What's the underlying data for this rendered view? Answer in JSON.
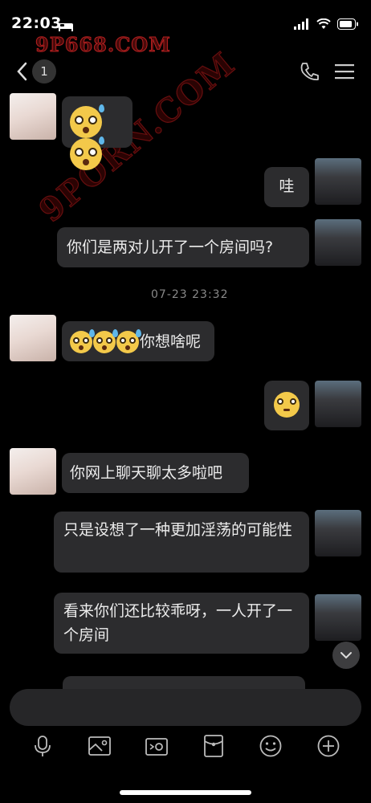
{
  "status_bar": {
    "time": "22:03"
  },
  "watermark": {
    "top_text": "9P668.COM",
    "diagonal_text": "9PORN.COM"
  },
  "header": {
    "unread_count": "1",
    "icons": [
      "back-chevron-icon",
      "phone-icon",
      "menu-icon"
    ]
  },
  "messages": [
    {
      "side": "left",
      "type": "emoji",
      "emojis": [
        "sweat-stare",
        "sweat-stare"
      ]
    },
    {
      "side": "right",
      "type": "text",
      "text": "哇"
    },
    {
      "side": "right",
      "type": "text",
      "text": "你们是两对儿开了一个房间吗?"
    },
    {
      "type": "timestamp",
      "text": "07-23 23:32"
    },
    {
      "side": "left",
      "type": "mixed",
      "emojis": [
        "sweat-stare",
        "sweat-stare",
        "sweat-stare"
      ],
      "text": "你想啥呢"
    },
    {
      "side": "right",
      "type": "emoji",
      "emojis": [
        "pensive"
      ]
    },
    {
      "side": "left",
      "type": "text",
      "text": "你网上聊天聊太多啦吧"
    },
    {
      "side": "right",
      "type": "text",
      "text": "只是设想了一种更加淫荡的可能性"
    },
    {
      "side": "right",
      "type": "text",
      "text": "看来你们还比较乖呀，一人开了一个房间"
    }
  ],
  "toolbar": {
    "icons": [
      "microphone-icon",
      "image-icon",
      "camera-icon",
      "red-packet-icon",
      "emoji-icon",
      "plus-icon"
    ]
  },
  "colors": {
    "background": "#000000",
    "bubble": "#2c2c2e",
    "watermark": "#b52020"
  }
}
